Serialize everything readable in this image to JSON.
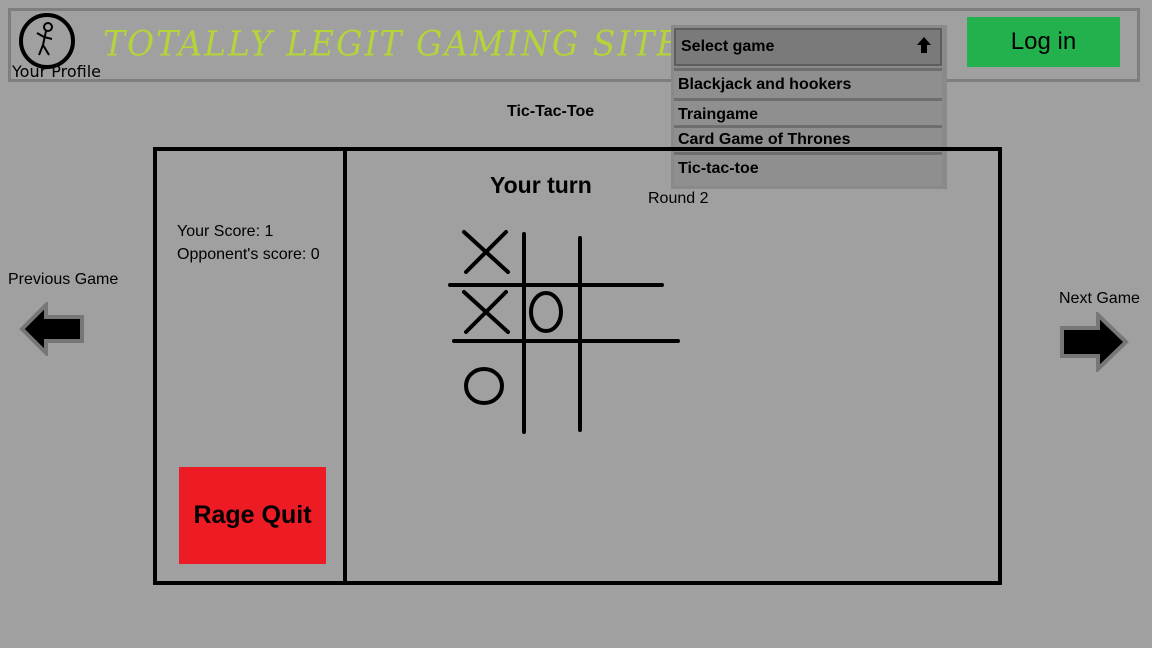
{
  "header": {
    "site_title": "TOTALLY LEGIT GAMING SITE",
    "profile_label": "Your Profile",
    "login_label": "Log in",
    "brand_color": "#b5d43a"
  },
  "game_select": {
    "label": "Select game",
    "options": [
      "Blackjack and hookers",
      "Traingame",
      "Card Game of Thrones",
      "Tic-tac-toe"
    ]
  },
  "game": {
    "name": "Tic-Tac-Toe",
    "turn": "Your turn",
    "round": "Round 2",
    "your_score": "Your Score: 1",
    "opponent_score": "Opponent's score: 0",
    "rage_quit_label": "Rage Quit",
    "board": [
      [
        "X",
        "",
        ""
      ],
      [
        "X",
        "O",
        ""
      ],
      [
        "O",
        "",
        ""
      ]
    ]
  },
  "nav": {
    "previous_label": "Previous Game",
    "next_label": "Next Game"
  },
  "colors": {
    "background": "#a0a0a0",
    "login": "#22b14c",
    "rage_quit": "#ed1c24"
  }
}
